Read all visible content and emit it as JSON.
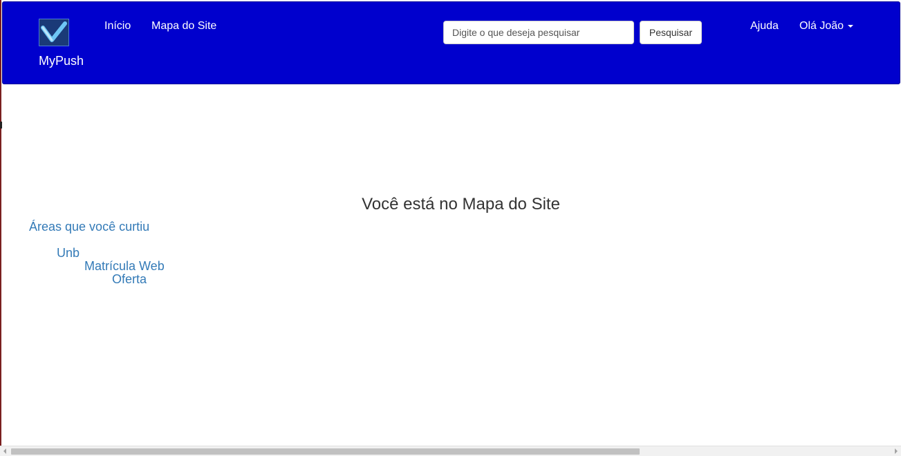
{
  "navbar": {
    "brand": "MyPush",
    "links": [
      {
        "label": "Início"
      },
      {
        "label": "Mapa do Site"
      }
    ],
    "search": {
      "placeholder": "Digite o que deseja pesquisar",
      "value": "",
      "button_label": "Pesquisar"
    },
    "help_label": "Ajuda",
    "user_menu_label": "Olá João",
    "background_color": "#0000cd"
  },
  "main": {
    "heading": "Você está no Mapa do Site",
    "tree": {
      "root": "Áreas que você curtiu",
      "level1": "Unb",
      "level2": "Matrícula Web",
      "level3": "Oferta"
    },
    "link_color": "#337ab7"
  },
  "icons": {
    "logo": "checkmark-logo-icon",
    "user_menu": "caret-down-icon"
  }
}
